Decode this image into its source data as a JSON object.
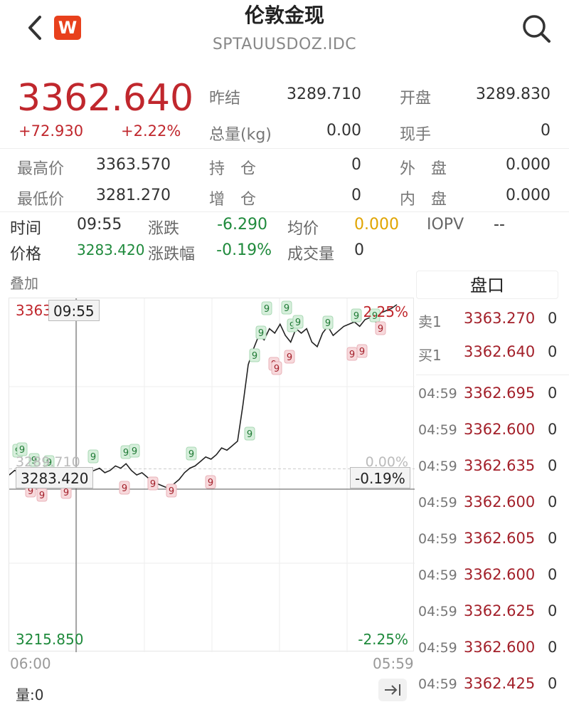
{
  "header": {
    "title": "伦敦金现",
    "subtitle": "SPTAUUSDOZ.IDC",
    "logo_letter": "W"
  },
  "quote": {
    "price": "3362.640",
    "change": "+72.930",
    "change_pct": "+2.22%",
    "fields": [
      {
        "label": "昨结",
        "value": "3289.710"
      },
      {
        "label": "开盘",
        "value": "3289.830"
      },
      {
        "label": "总量(kg)",
        "value": "0.00"
      },
      {
        "label": "现手",
        "value": "0"
      },
      {
        "label": "最高价",
        "value": "3363.570"
      },
      {
        "label": "持　仓",
        "value": "0"
      },
      {
        "label": "外　盘",
        "value": "0.000"
      },
      {
        "label": "最低价",
        "value": "3281.270"
      },
      {
        "label": "增　仓",
        "value": "0"
      },
      {
        "label": "内　盘",
        "value": "0.000"
      }
    ]
  },
  "cursor_info": {
    "time_label": "时间",
    "time": "09:55",
    "chg_label": "涨跌",
    "chg": "-6.290",
    "avg_label": "均价",
    "avg": "0.000",
    "iopv_label": "IOPV",
    "iopv": "--",
    "price_label": "价格",
    "price": "3283.420",
    "pct_label": "涨跌幅",
    "pct": "-0.19%",
    "vol_label": "成交量",
    "vol": "0"
  },
  "chart": {
    "overlay_label": "叠加",
    "top_left": "3363",
    "crosshair_time": "09:55",
    "top_right_pct": "2.25%",
    "base_price": "3289.710",
    "base_pct": "0.00%",
    "crosshair_price": "3283.420",
    "crosshair_pct": "-0.19%",
    "bottom_left": "3215.850",
    "bottom_right_pct": "-2.25%",
    "x_start": "06:00",
    "x_end": "05:59",
    "volume_label": "量:0",
    "marker_glyph": "9"
  },
  "chart_data": {
    "type": "line",
    "x_range": [
      "06:00",
      "05:59"
    ],
    "ylim": [
      3215.85,
      3363.57
    ],
    "prev_settle": 3289.71,
    "series": [
      {
        "values": [
          3287,
          3289,
          3288,
          3290,
          3286,
          3287,
          3289,
          3288,
          3285,
          3287,
          3286,
          3288,
          3287,
          3285,
          3286,
          3288,
          3289,
          3290,
          3288,
          3289,
          3291,
          3290,
          3292,
          3289,
          3287,
          3288,
          3286,
          3284,
          3283,
          3282,
          3281,
          3283,
          3285,
          3288,
          3290,
          3291,
          3293,
          3295,
          3294,
          3296,
          3299,
          3298,
          3300,
          3302,
          3318,
          3336,
          3343,
          3349,
          3347,
          3352,
          3350,
          3354,
          3349,
          3346,
          3352,
          3350,
          3352,
          3346,
          3344,
          3350,
          3353,
          3349,
          3351,
          3353,
          3354,
          3355,
          3353,
          3356,
          3357,
          3355,
          3359,
          3360,
          3361,
          3362.64
        ]
      }
    ]
  },
  "orderbook": {
    "title": "盘口",
    "asks": [
      {
        "label": "卖1",
        "price": "3363.270",
        "qty": "0"
      }
    ],
    "bids": [
      {
        "label": "买1",
        "price": "3362.640",
        "qty": "0"
      }
    ],
    "ticks": [
      {
        "time": "04:59",
        "price": "3362.695",
        "qty": "0"
      },
      {
        "time": "04:59",
        "price": "3362.600",
        "qty": "0"
      },
      {
        "time": "04:59",
        "price": "3362.635",
        "qty": "0"
      },
      {
        "time": "04:59",
        "price": "3362.600",
        "qty": "0"
      },
      {
        "time": "04:59",
        "price": "3362.605",
        "qty": "0"
      },
      {
        "time": "04:59",
        "price": "3362.600",
        "qty": "0"
      },
      {
        "time": "04:59",
        "price": "3362.625",
        "qty": "0"
      },
      {
        "time": "04:59",
        "price": "3362.600",
        "qty": "0"
      },
      {
        "time": "04:59",
        "price": "3362.425",
        "qty": "0"
      }
    ]
  },
  "colors": {
    "up": "#c0272d",
    "down": "#1f8a3c",
    "avg": "#e0a400",
    "line": "#222222"
  }
}
